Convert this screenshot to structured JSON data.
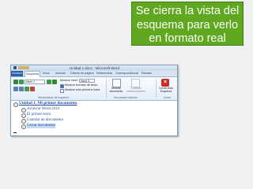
{
  "callout": {
    "line1": "Se cierra la vista del",
    "line2": "esquema para verlo",
    "line3": "en formato real"
  },
  "window": {
    "title": "Unidad 1.docx - Microsoft Word"
  },
  "tabs": [
    "Archivo",
    "Esquema",
    "Inicio",
    "Insertar",
    "Diseño de página",
    "Referencias",
    "Correspondencia",
    "Revisar"
  ],
  "ribbon": {
    "level_value": "Nivel 2",
    "show_level_label": "Mostrar nivel:",
    "show_level_value": "Nivel 3",
    "show_text_format": "Mostrar formato de texto",
    "show_first_line": "Mostrar sólo primera línea",
    "group_outline_tools": "Herramientas de esquema",
    "show_document": "Mostrar documento",
    "collapse_subdocs": "Contraer subdocumentos",
    "group_master_doc": "Documento maestro",
    "close_outline": "Cerrar vista Esquema",
    "group_close": "Cerrar"
  },
  "document": {
    "heading": "Unidad 1. Mi primer documento",
    "items": [
      "Arrancar Word 2010",
      "El primer texto",
      "Guardar un documento",
      "Cerrar documento"
    ]
  },
  "colors": {
    "callout_bg": "#60a820",
    "link_text": "#1f4e99",
    "file_tab": "#2a5fa8"
  }
}
